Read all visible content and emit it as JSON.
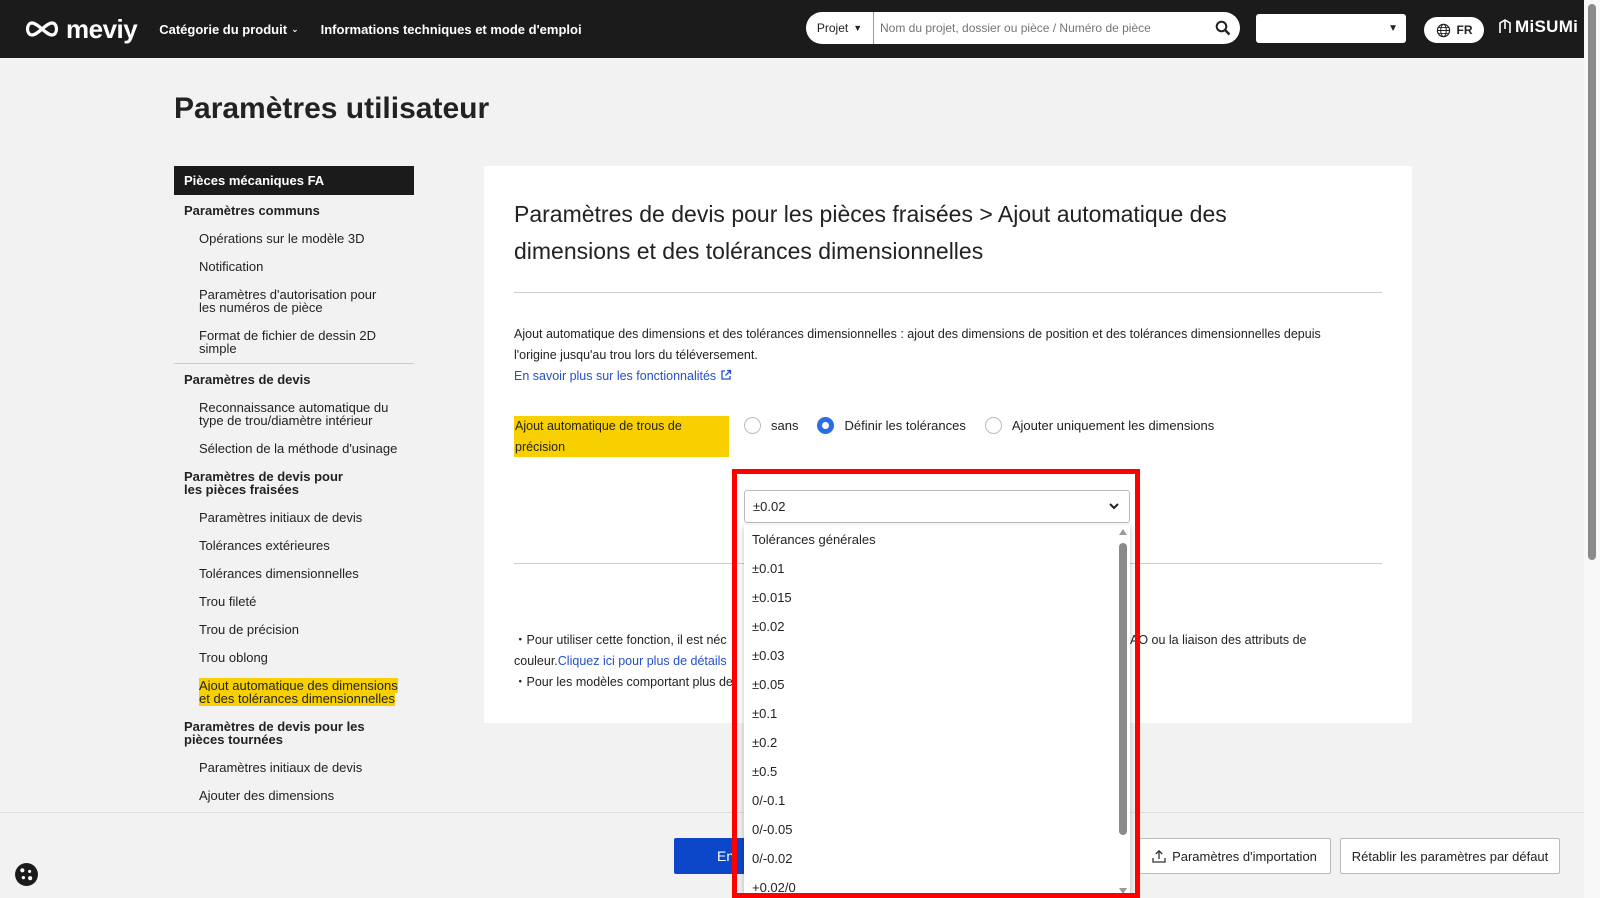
{
  "header": {
    "logo_text": "meviy",
    "nav": [
      {
        "label": "Catégorie du produit"
      },
      {
        "label": "Informations techniques et mode d'emploi"
      }
    ],
    "search_scope": "Projet",
    "search_placeholder": "Nom du projet, dossier ou pièce / Numéro de pièce",
    "lang": "FR",
    "brand": "MiSUMi"
  },
  "page": {
    "title": "Paramètres utilisateur"
  },
  "sidebar": {
    "head": "Pièces mécaniques FA",
    "common_title": "Paramètres communs",
    "common_items": [
      "Opérations sur le modèle 3D",
      "Notification",
      "Paramètres d'autorisation pour les numéros de pièce",
      "Format de fichier de dessin 2D simple"
    ],
    "quote_title": "Paramètres de devis",
    "quote_items": [
      "Reconnaissance automatique du type de trou/diamètre intérieur",
      "Sélection de la méthode d'usinage"
    ],
    "milled_title": "Paramètres de devis pour les pièces fraisées",
    "milled_items": [
      "Paramètres initiaux de devis",
      "Tolérances extérieures",
      "Tolérances dimensionnelles",
      "Trou fileté",
      "Trou de précision",
      "Trou oblong",
      "Ajout automatique des dimensions et des tolérances dimensionnelles"
    ],
    "turned_title": "Paramètres de devis pour les pièces tournées",
    "turned_items": [
      "Paramètres initiaux de devis",
      "Ajouter des dimensions"
    ]
  },
  "content": {
    "title": "Paramètres de devis pour les pièces fraisées > Ajout automatique des dimensions et des tolérances dimensionnelles",
    "description": "Ajout automatique des dimensions et des tolérances dimensionnelles : ajout des dimensions de position et des tolérances dimensionnelles depuis l'origine jusqu'au trou lors du téléversement.",
    "learn_more": "En savoir plus sur les fonctionnalités",
    "precision_label": "Ajout automatique de trous de précision",
    "radio_options": [
      "sans",
      "Définir les tolérances",
      "Ajouter uniquement les dimensions"
    ],
    "selected_radio": "Définir les tolérances",
    "note1_start": "・Pour utiliser cette fonction, il est néc",
    "note1_end": "AO ou la liaison des attributs de",
    "note1_line2": "couleur.",
    "note1_link": "Cliquez ici pour plus de détails",
    "note2_start": "・Pour les modèles comportant plus de"
  },
  "dropdown": {
    "selected": "±0.02",
    "options": [
      "Tolérances générales",
      "±0.01",
      "±0.015",
      "±0.02",
      "±0.03",
      "±0.05",
      "±0.1",
      "±0.2",
      "±0.5",
      "0/-0.1",
      "0/-0.05",
      "0/-0.02",
      "+0.02/0"
    ]
  },
  "footer": {
    "primary_label": "En",
    "import_label": "Paramètres d'importation",
    "reset_label": "Rétablir les paramètres par défaut"
  },
  "colors": {
    "highlight_yellow": "#f8d000",
    "primary_blue": "#0d47c9",
    "annotation_red": "#ff0000"
  }
}
